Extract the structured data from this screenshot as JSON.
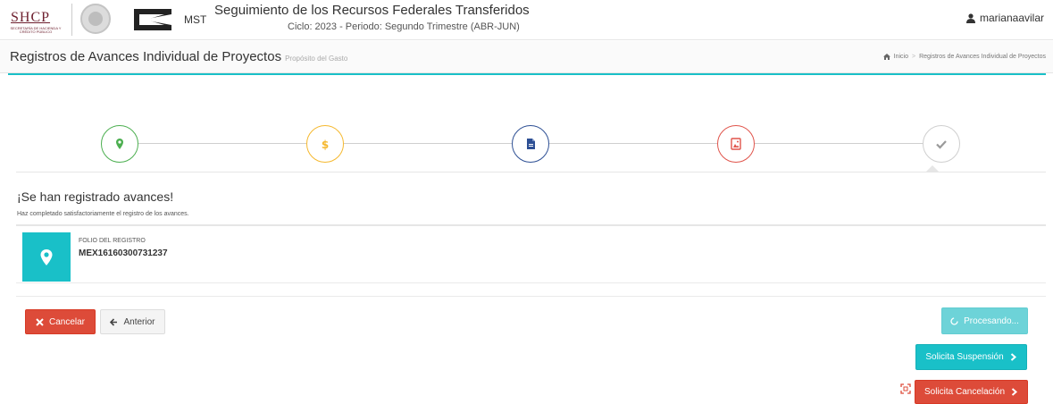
{
  "header": {
    "logo_text": "SHCP",
    "logo_subtext": "SECRETARÍA DE HACIENDA Y CRÉDITO PÚBLICO",
    "mst_label": "MST",
    "app_title": "Seguimiento de los Recursos Federales Transferidos",
    "app_subtitle": "Ciclo: 2023 - Periodo: Segundo Trimestre (ABR-JUN)",
    "user_name": "marianaavilar"
  },
  "page": {
    "title": "Registros de Avances Individual de Proyectos",
    "subtitle": "Propósito del Gasto",
    "breadcrumb": [
      "Inicio",
      "Registros de Avances Individual de Proyectos"
    ]
  },
  "steps": [
    {
      "icon": "map-marker-icon",
      "color": "#4caf50"
    },
    {
      "icon": "dollar-icon",
      "color": "#f5b82e"
    },
    {
      "icon": "document-icon",
      "color": "#2d4f94"
    },
    {
      "icon": "image-icon",
      "color": "#e0544b"
    },
    {
      "icon": "check-icon",
      "color": "#9a9a9a"
    }
  ],
  "result": {
    "title": "¡Se han registrado avances!",
    "message": "Haz completado satisfactoriamente el registro de los avances.",
    "folio_label": "FOLIO DEL REGISTRO",
    "folio_value": "MEX16160300731237"
  },
  "buttons": {
    "cancel": "Cancelar",
    "previous": "Anterior",
    "processing": "Procesando...",
    "request_suspension": "Solicita Suspensión",
    "request_cancellation": "Solicita Cancelación"
  },
  "colors": {
    "accent": "#19c0c8",
    "danger": "#dd4b39",
    "brand": "#6d1f2e"
  }
}
